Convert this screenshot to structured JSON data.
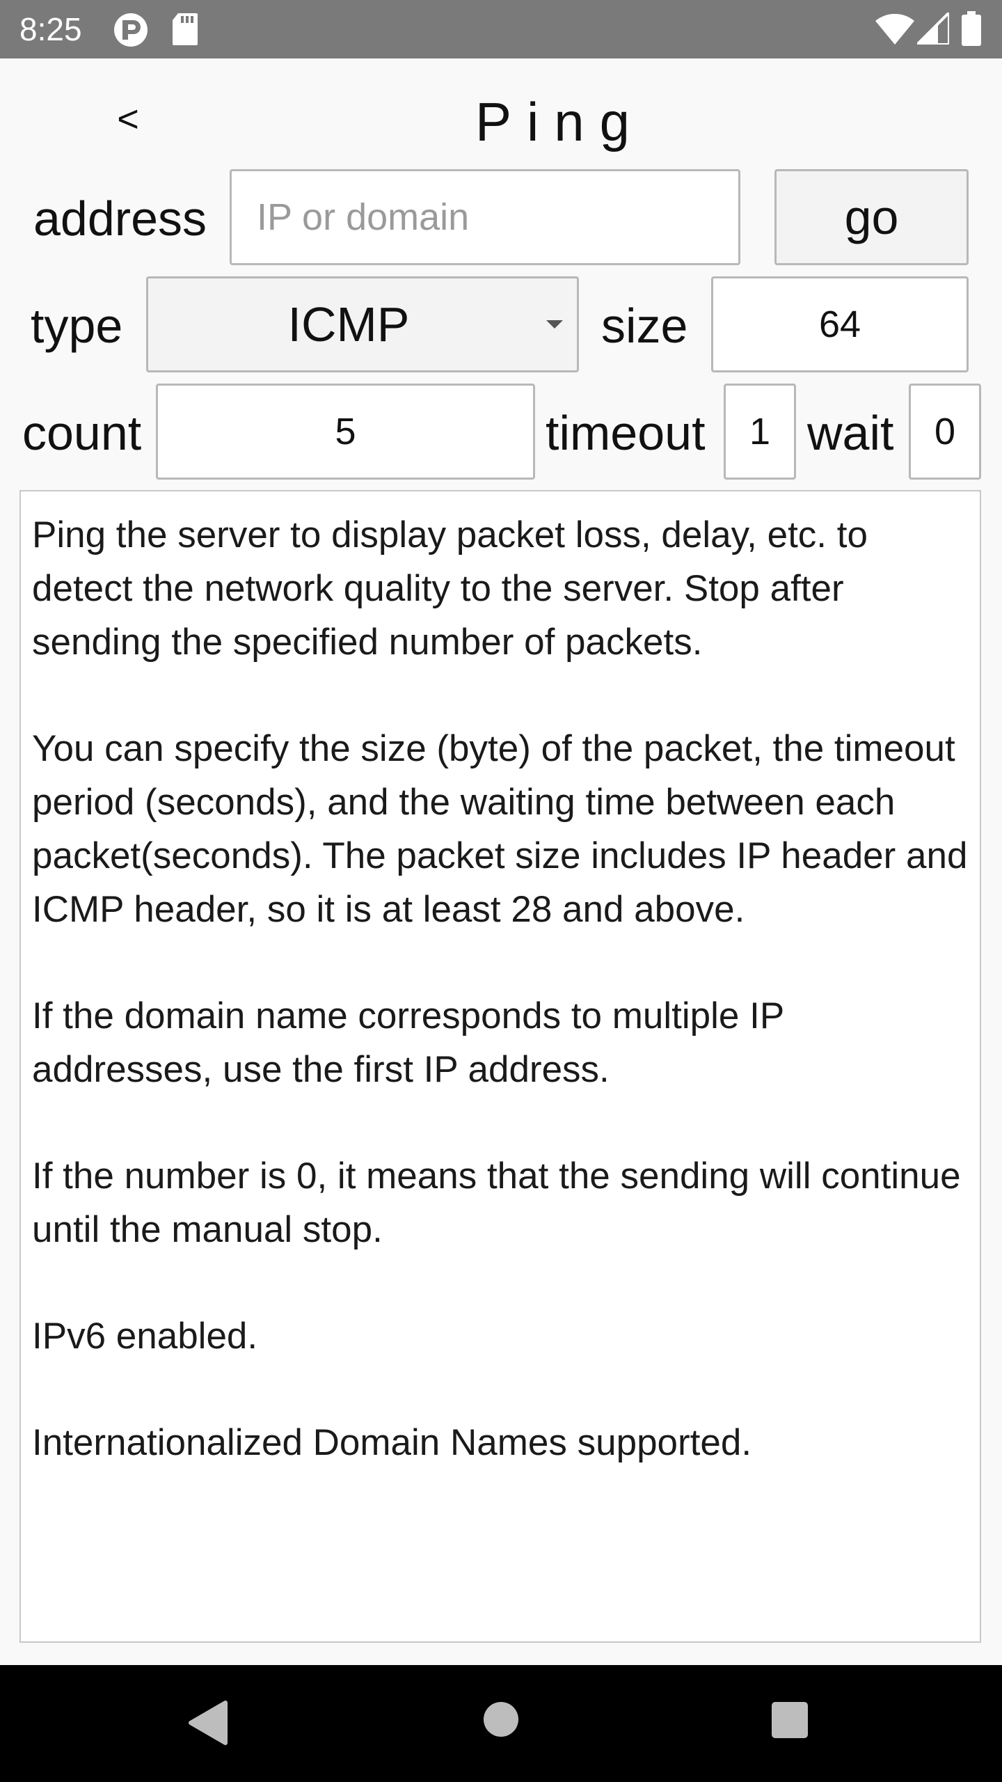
{
  "status_bar": {
    "time": "8:25",
    "left_icons": [
      "app-notification-icon",
      "sd-card-icon"
    ],
    "right_icons": [
      "wifi-icon",
      "cellular-signal-icon",
      "battery-icon"
    ]
  },
  "header": {
    "back_label": "<",
    "title": "Ping"
  },
  "form": {
    "address_label": "address",
    "address_placeholder": "IP or domain",
    "address_value": "",
    "go_label": "go",
    "type_label": "type",
    "type_value": "ICMP",
    "size_label": "size",
    "size_value": "64",
    "count_label": "count",
    "count_value": "5",
    "timeout_label": "timeout",
    "timeout_value": "1",
    "wait_label": "wait",
    "wait_value": "0"
  },
  "description": {
    "paragraphs": [
      "Ping the server to display packet loss, delay, etc. to detect the network quality to the server. Stop after sending the specified number of packets.",
      "You can specify the size (byte) of the packet, the timeout period (seconds), and the waiting time between each packet(seconds). The packet size includes IP header and ICMP header, so it is at least 28 and above.",
      "If the domain name corresponds to multiple IP addresses, use the first IP address.",
      "If the number is 0, it means that the sending will continue until the manual stop.",
      "IPv6 enabled.",
      "Internationalized Domain Names supported."
    ]
  },
  "nav_bar": {
    "buttons": [
      "back-triangle-icon",
      "home-circle-icon",
      "recents-square-icon"
    ]
  }
}
